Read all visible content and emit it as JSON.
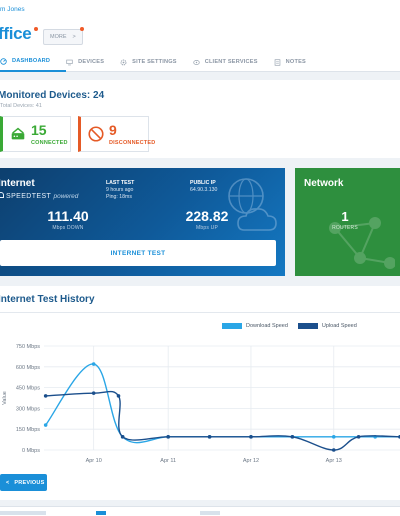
{
  "header": {
    "owner": "m Jones",
    "site_title": "ffice",
    "more_label": "MORE",
    "more_chevron": ">"
  },
  "tabs": [
    {
      "label": "DASHBOARD",
      "icon": "gauge-icon",
      "active": true
    },
    {
      "label": "DEVICES",
      "icon": "devices-icon",
      "active": false
    },
    {
      "label": "SITE SETTINGS",
      "icon": "settings-icon",
      "active": false
    },
    {
      "label": "CLIENT SERVICES",
      "icon": "client-services-icon",
      "active": false
    },
    {
      "label": "NOTES",
      "icon": "notes-icon",
      "active": false
    }
  ],
  "devices": {
    "title": "Monitored Devices: 24",
    "total": "Total Devices: 41",
    "connected_count": "15",
    "connected_label": "CONNECTED",
    "disconnected_count": "9",
    "disconnected_label": "DISCONNECTED"
  },
  "internet": {
    "title": "Internet",
    "speedtest_brand": "SPEEDTEST",
    "speedtest_powered": "powered",
    "last_test_label": "LAST TEST",
    "last_test_time": "9 hours ago",
    "last_test_ping": "Ping:  18ms",
    "public_ip_label": "PUBLIC IP",
    "public_ip_value": "64.90.3.130",
    "down_value": "111.40",
    "down_label": "Mbps DOWN",
    "up_value": "228.82",
    "up_label": "Mbps UP",
    "test_button": "INTERNET TEST"
  },
  "network": {
    "title": "Network",
    "routers_count": "1",
    "routers_label": "ROUTERS"
  },
  "history": {
    "title": "Internet Test History",
    "previous_button": "PREVIOUS",
    "previous_chevron": "<"
  },
  "colors": {
    "accent": "#1a8fd8",
    "green": "#3aa935",
    "red": "#e55a26",
    "download": "#2aa6e6",
    "upload": "#1b4f8c",
    "network_bg": "#2e8f3e"
  },
  "chart_data": {
    "type": "line",
    "ylabel": "Value",
    "xlabel": "",
    "yticks": [
      "0 Mbps",
      "150 Mbps",
      "300 Mbps",
      "450 Mbps",
      "600 Mbps",
      "750 Mbps"
    ],
    "ylim": [
      0,
      750
    ],
    "x_ticks": [
      "Apr 10",
      "Apr 11",
      "Apr 12",
      "Apr 13"
    ],
    "x_tick_positions": [
      0.1,
      1.0,
      2.0,
      3.0
    ],
    "xlim": [
      -0.5,
      3.8
    ],
    "legend": "top-center",
    "grid": true,
    "series": [
      {
        "name": "Download Speed",
        "color": "#2aa6e6",
        "x": [
          -0.48,
          0.1,
          0.45,
          1.0,
          1.5,
          2.0,
          2.5,
          3.0,
          3.5,
          3.8
        ],
        "y": [
          180,
          620,
          95,
          95,
          95,
          95,
          95,
          95,
          95,
          95
        ]
      },
      {
        "name": "Upload Speed",
        "color": "#1b4f8c",
        "x": [
          -0.48,
          0.1,
          0.4,
          0.45,
          1.0,
          1.5,
          2.0,
          2.5,
          3.0,
          3.3,
          3.8
        ],
        "y": [
          390,
          410,
          390,
          95,
          95,
          95,
          95,
          95,
          0,
          95,
          95
        ]
      }
    ]
  }
}
